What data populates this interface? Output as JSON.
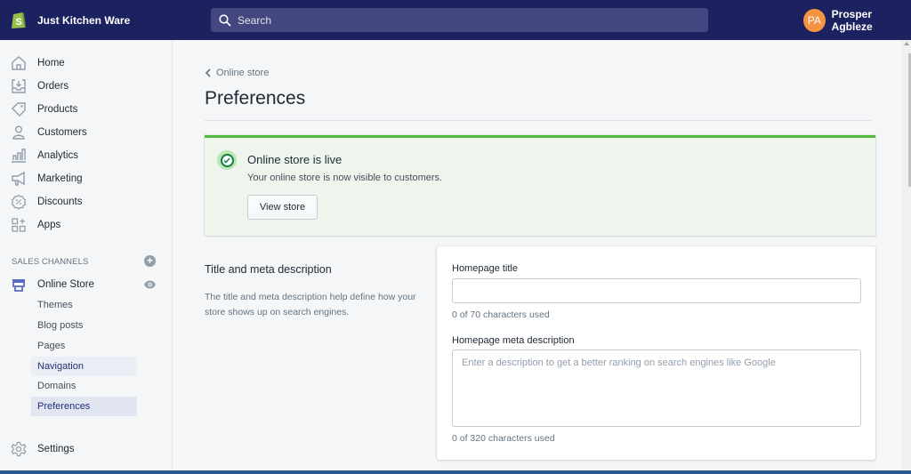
{
  "topbar": {
    "store_name": "Just Kitchen Ware",
    "search_placeholder": "Search",
    "user_initials": "PA",
    "user_name": "Prosper Agbleze",
    "colors": {
      "bar": "#1c2260",
      "search": "#43467f",
      "avatar": "#f49342",
      "logo": "#95bf47"
    }
  },
  "sidebar": {
    "items": [
      {
        "label": "Home",
        "icon": "home-icon"
      },
      {
        "label": "Orders",
        "icon": "orders-icon"
      },
      {
        "label": "Products",
        "icon": "tag-icon"
      },
      {
        "label": "Customers",
        "icon": "person-icon"
      },
      {
        "label": "Analytics",
        "icon": "bar-chart-icon"
      },
      {
        "label": "Marketing",
        "icon": "megaphone-icon"
      },
      {
        "label": "Discounts",
        "icon": "discount-icon"
      },
      {
        "label": "Apps",
        "icon": "apps-icon"
      }
    ],
    "sales_channels_label": "SALES CHANNELS",
    "online_store_label": "Online Store",
    "sub_items": [
      {
        "label": "Themes",
        "state": "normal"
      },
      {
        "label": "Blog posts",
        "state": "normal"
      },
      {
        "label": "Pages",
        "state": "normal"
      },
      {
        "label": "Navigation",
        "state": "hover"
      },
      {
        "label": "Domains",
        "state": "normal"
      },
      {
        "label": "Preferences",
        "state": "active"
      }
    ],
    "settings_label": "Settings"
  },
  "main": {
    "breadcrumb": "Online store",
    "title": "Preferences",
    "banner": {
      "title": "Online store is live",
      "text": "Your online store is now visible to customers.",
      "button": "View store",
      "colors": {
        "accent": "#50b83c",
        "background": "#eef5ec"
      }
    },
    "section": {
      "title": "Title and meta description",
      "description": "The title and meta description help define how your store shows up on search engines."
    },
    "form": {
      "homepage_title_label": "Homepage title",
      "homepage_title_value": "",
      "homepage_title_help": "0 of 70 characters used",
      "meta_label": "Homepage meta description",
      "meta_placeholder": "Enter a description to get a better ranking on search engines like Google",
      "meta_help": "0 of 320 characters used"
    }
  }
}
